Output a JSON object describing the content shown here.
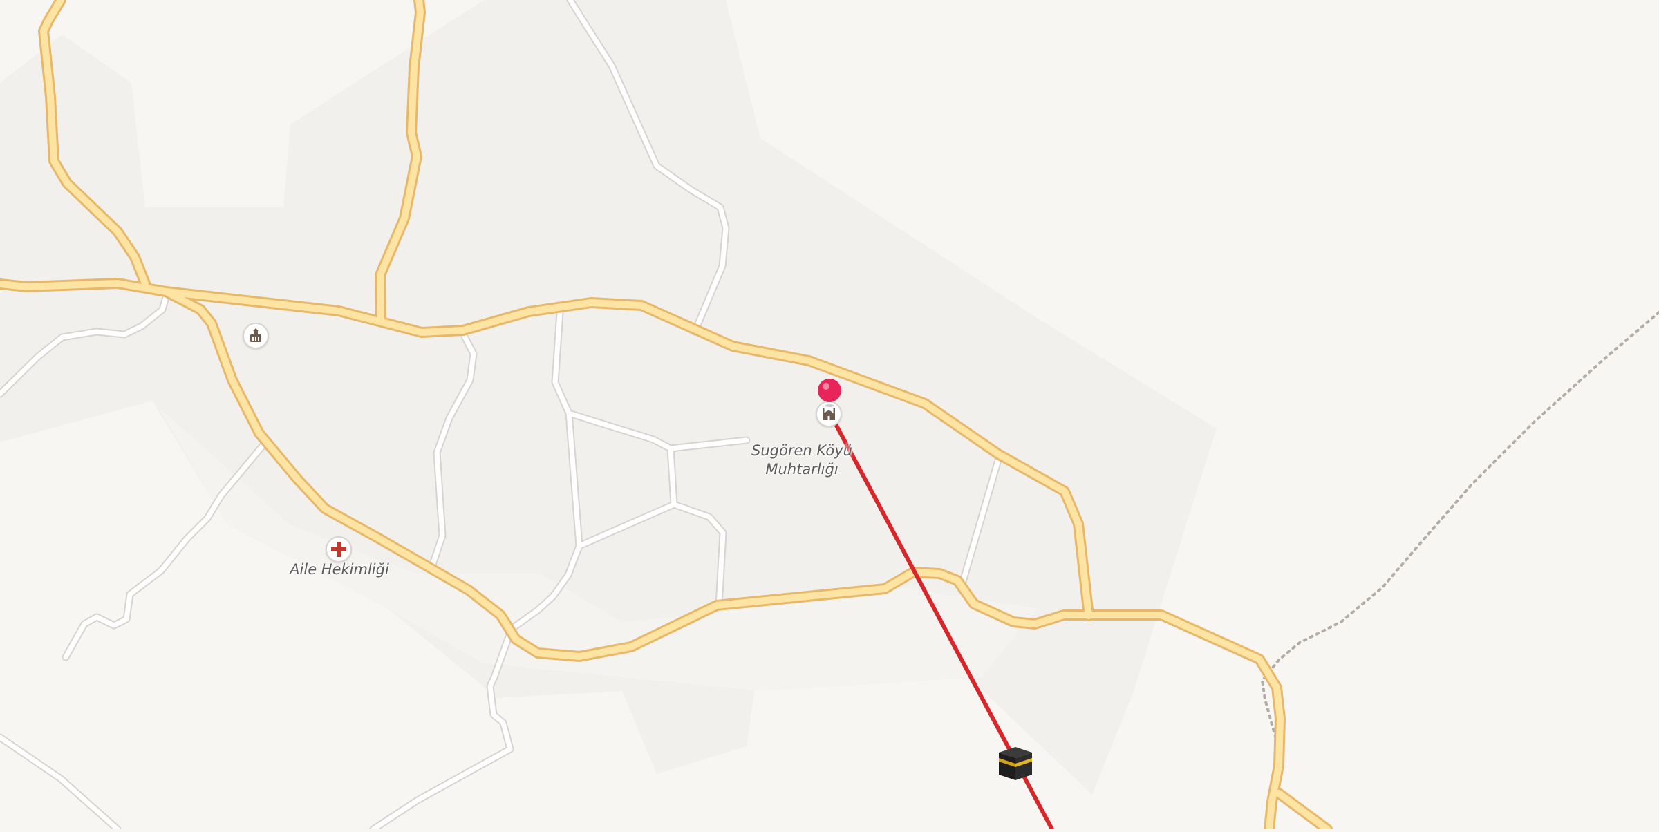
{
  "map": {
    "labels": {
      "muhtarlik_line1": "Sugören Köyü",
      "muhtarlik_line2": "Muhtarlığı",
      "health_center": "Aile Hekimliği"
    },
    "icons": [
      "government-building-icon",
      "health-clinic-icon",
      "mosque-icon",
      "kaaba-qibla-icon",
      "location-pin-icon"
    ],
    "colors": {
      "background": "#f8f6f3",
      "land_shade": "#f1efec",
      "primary_road_fill": "#fde4a2",
      "primary_road_casing": "#e8b86a",
      "minor_road_fill": "#ffffff",
      "minor_road_casing": "#d7d3cf",
      "qibla_line": "#d9262b",
      "pin": "#e8245a",
      "path_dotted": "#b3aca7",
      "health_cross": "#c0392b"
    }
  }
}
